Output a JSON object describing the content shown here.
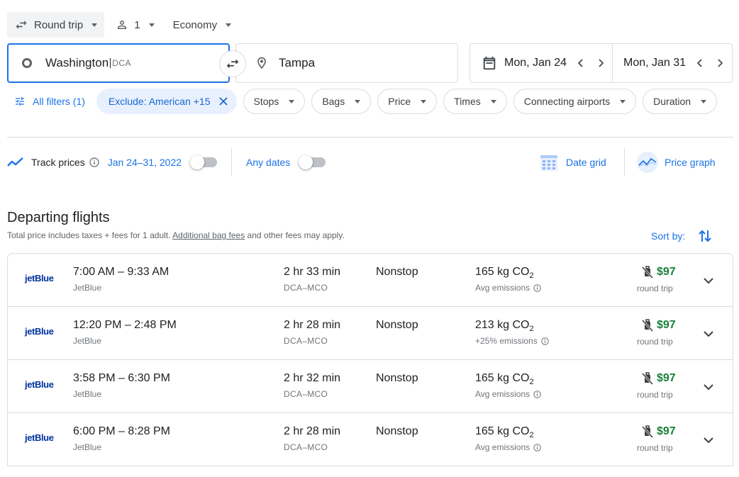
{
  "top": {
    "trip_type": "Round trip",
    "passengers": "1",
    "cabin": "Economy"
  },
  "search": {
    "origin": "Washington",
    "origin_code": "DCA",
    "destination": "Tampa",
    "depart_date": "Mon, Jan 24",
    "return_date": "Mon, Jan 31"
  },
  "filters": {
    "all_filters": "All filters (1)",
    "exclude": "Exclude: American +15",
    "chips": [
      "Stops",
      "Bags",
      "Price",
      "Times",
      "Connecting airports",
      "Duration"
    ]
  },
  "tracking": {
    "label": "Track prices",
    "range": "Jan 24–31, 2022",
    "any_dates": "Any dates",
    "date_grid": "Date grid",
    "price_graph": "Price graph"
  },
  "departing": {
    "title": "Departing flights",
    "subtitle_pre": "Total price includes taxes + fees for 1 adult. ",
    "subtitle_link": "Additional bag fees",
    "subtitle_post": " and other fees may apply.",
    "sort_by": "Sort by:"
  },
  "flights": [
    {
      "logo": "jetBlue",
      "times": "7:00 AM – 9:33 AM",
      "airline": "JetBlue",
      "duration": "2 hr 33 min",
      "route": "DCA–MCO",
      "stops": "Nonstop",
      "co2": "165 kg CO",
      "co2_sub": "2",
      "emissions": "Avg emissions",
      "price": "$97",
      "price_type": "round trip"
    },
    {
      "logo": "jetBlue",
      "times": "12:20 PM – 2:48 PM",
      "airline": "JetBlue",
      "duration": "2 hr 28 min",
      "route": "DCA–MCO",
      "stops": "Nonstop",
      "co2": "213 kg CO",
      "co2_sub": "2",
      "emissions": "+25% emissions",
      "price": "$97",
      "price_type": "round trip"
    },
    {
      "logo": "jetBlue",
      "times": "3:58 PM – 6:30 PM",
      "airline": "JetBlue",
      "duration": "2 hr 32 min",
      "route": "DCA–MCO",
      "stops": "Nonstop",
      "co2": "165 kg CO",
      "co2_sub": "2",
      "emissions": "Avg emissions",
      "price": "$97",
      "price_type": "round trip"
    },
    {
      "logo": "jetBlue",
      "times": "6:00 PM – 8:28 PM",
      "airline": "JetBlue",
      "duration": "2 hr 28 min",
      "route": "DCA–MCO",
      "stops": "Nonstop",
      "co2": "165 kg CO",
      "co2_sub": "2",
      "emissions": "Avg emissions",
      "price": "$97",
      "price_type": "round trip"
    }
  ],
  "colors": {
    "accent": "#1a73e8",
    "price": "#188038",
    "border": "#dadce0"
  }
}
